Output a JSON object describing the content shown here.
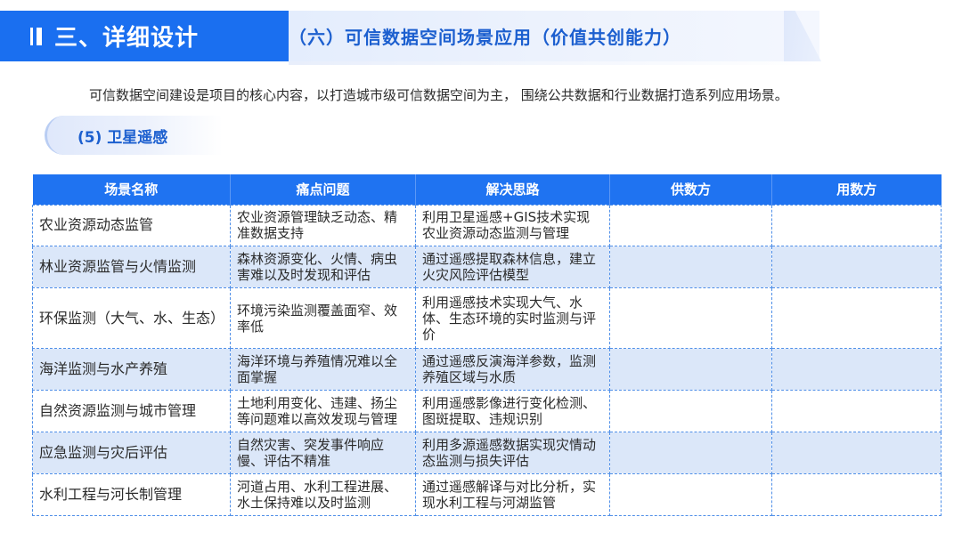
{
  "header": {
    "section_title": "三、详细设计",
    "subsection_title": "（六）可信数据空间场景应用（价值共创能力）"
  },
  "intro": "可信数据空间建设是项目的核心内容，以打造城市级可信数据空间为主， 围绕公共数据和行业数据打造系列应用场景。",
  "tag": "(5) 卫星遥感",
  "table": {
    "columns": [
      "场景名称",
      "痛点问题",
      "解决思路",
      "供数方",
      "用数方"
    ],
    "rows": [
      {
        "name": "农业资源动态监管",
        "pain": "农业资源管理缺乏动态、精准数据支持",
        "solution": "利用卫星遥感+GIS技术实现 农业资源动态监测与管理",
        "supplier": "",
        "user": ""
      },
      {
        "name": "林业资源监管与火情监测",
        "pain": "森林资源变化、火情、病虫害难以及时发现和评估",
        "solution": "通过遥感提取森林信息，建立火灾风险评估模型",
        "supplier": "",
        "user": ""
      },
      {
        "name": "环保监测（大气、水、生态）",
        "pain": "环境污染监测覆盖面窄、效率低",
        "solution": "利用遥感技术实现大气、水体、生态环境的实时监测与评价",
        "supplier": "",
        "user": ""
      },
      {
        "name": "海洋监测与水产养殖",
        "pain": "海洋环境与养殖情况难以全面掌握",
        "solution": "通过遥感反演海洋参数，监测养殖区域与水质",
        "supplier": "",
        "user": ""
      },
      {
        "name": "自然资源监测与城市管理",
        "pain": "土地利用变化、违建、扬尘等问题难以高效发现与管理",
        "solution": "利用遥感影像进行变化检测、图斑提取、违规识别",
        "supplier": "",
        "user": ""
      },
      {
        "name": "应急监测与灾后评估",
        "pain": "自然灾害、突发事件响应慢、评估不精准",
        "solution": "利用多源遥感数据实现灾情动态监测与损失评估",
        "supplier": "",
        "user": ""
      },
      {
        "name": "水利工程与河长制管理",
        "pain": "河道占用、水利工程进展、水土保持难以及时监测",
        "solution": "通过遥感解译与对比分析，实现水利工程与河湖监管",
        "supplier": "",
        "user": ""
      }
    ]
  }
}
